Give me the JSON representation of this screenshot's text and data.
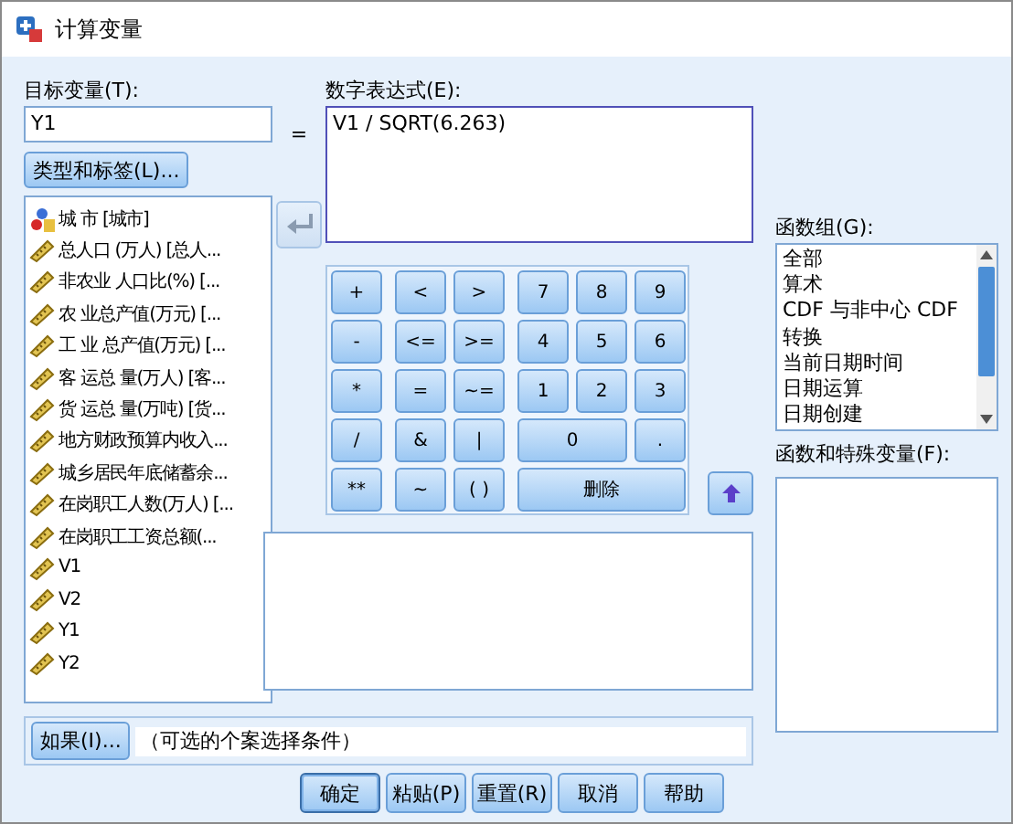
{
  "window": {
    "title": "计算变量"
  },
  "target": {
    "label": "目标变量(T):",
    "value": "Y1",
    "type_button": "类型和标签(L)..."
  },
  "equals": "=",
  "expression": {
    "label": "数字表达式(E):",
    "value": "V1 / SQRT(6.263)"
  },
  "variables": [
    {
      "kind": "nominal",
      "name": "城  市 [城市]"
    },
    {
      "kind": "scale",
      "name": "总人口 (万人) [总人..."
    },
    {
      "kind": "scale",
      "name": "非农业 人口比(%) [..."
    },
    {
      "kind": "scale",
      "name": "农  业总产值(万元) [..."
    },
    {
      "kind": "scale",
      "name": "工  业 总产值(万元) [..."
    },
    {
      "kind": "scale",
      "name": "客 运总 量(万人) [客..."
    },
    {
      "kind": "scale",
      "name": "货 运总 量(万吨) [货..."
    },
    {
      "kind": "scale",
      "name": "地方财政预算内收入..."
    },
    {
      "kind": "scale",
      "name": "城乡居民年底储蓄余..."
    },
    {
      "kind": "scale",
      "name": "在岗职工人数(万人) [..."
    },
    {
      "kind": "scale",
      "name": "在岗职工工资总额(..."
    },
    {
      "kind": "scale",
      "name": "V1"
    },
    {
      "kind": "scale",
      "name": "V2"
    },
    {
      "kind": "scale",
      "name": "Y1"
    },
    {
      "kind": "scale",
      "name": "Y2"
    }
  ],
  "keys": [
    {
      "label": "+",
      "kind": "single"
    },
    {
      "label": "<",
      "kind": "single"
    },
    {
      "label": ">",
      "kind": "single"
    },
    {
      "label": "7",
      "kind": "single"
    },
    {
      "label": "8",
      "kind": "single"
    },
    {
      "label": "9",
      "kind": "single"
    },
    {
      "label": "-",
      "kind": "single"
    },
    {
      "label": "<=",
      "kind": "single"
    },
    {
      "label": ">=",
      "kind": "single"
    },
    {
      "label": "4",
      "kind": "single"
    },
    {
      "label": "5",
      "kind": "single"
    },
    {
      "label": "6",
      "kind": "single"
    },
    {
      "label": "*",
      "kind": "single"
    },
    {
      "label": "=",
      "kind": "single"
    },
    {
      "label": "~=",
      "kind": "single"
    },
    {
      "label": "1",
      "kind": "single"
    },
    {
      "label": "2",
      "kind": "single"
    },
    {
      "label": "3",
      "kind": "single"
    },
    {
      "label": "/",
      "kind": "single"
    },
    {
      "label": "&",
      "kind": "single"
    },
    {
      "label": "|",
      "kind": "single"
    },
    {
      "label": "0",
      "kind": "double"
    },
    {
      "label": ".",
      "kind": "single"
    },
    {
      "label": "**",
      "kind": "single"
    },
    {
      "label": "~",
      "kind": "single"
    },
    {
      "label": "( )",
      "kind": "single"
    },
    {
      "label": "删除",
      "kind": "triple"
    }
  ],
  "function_group": {
    "label": "函数组(G):",
    "items": [
      "全部",
      "算术",
      "CDF 与非中心 CDF",
      "转换",
      "当前日期时间",
      "日期运算",
      "日期创建"
    ]
  },
  "functions": {
    "label": "函数和特殊变量(F):"
  },
  "condition": {
    "button": "如果(I)...",
    "text": "（可选的个案选择条件）"
  },
  "buttons": [
    {
      "label": "确定",
      "default": true
    },
    {
      "label": "粘贴(P)",
      "default": false
    },
    {
      "label": "重置(R)",
      "default": false
    },
    {
      "label": "取消",
      "default": false
    },
    {
      "label": "帮助",
      "default": false
    }
  ]
}
